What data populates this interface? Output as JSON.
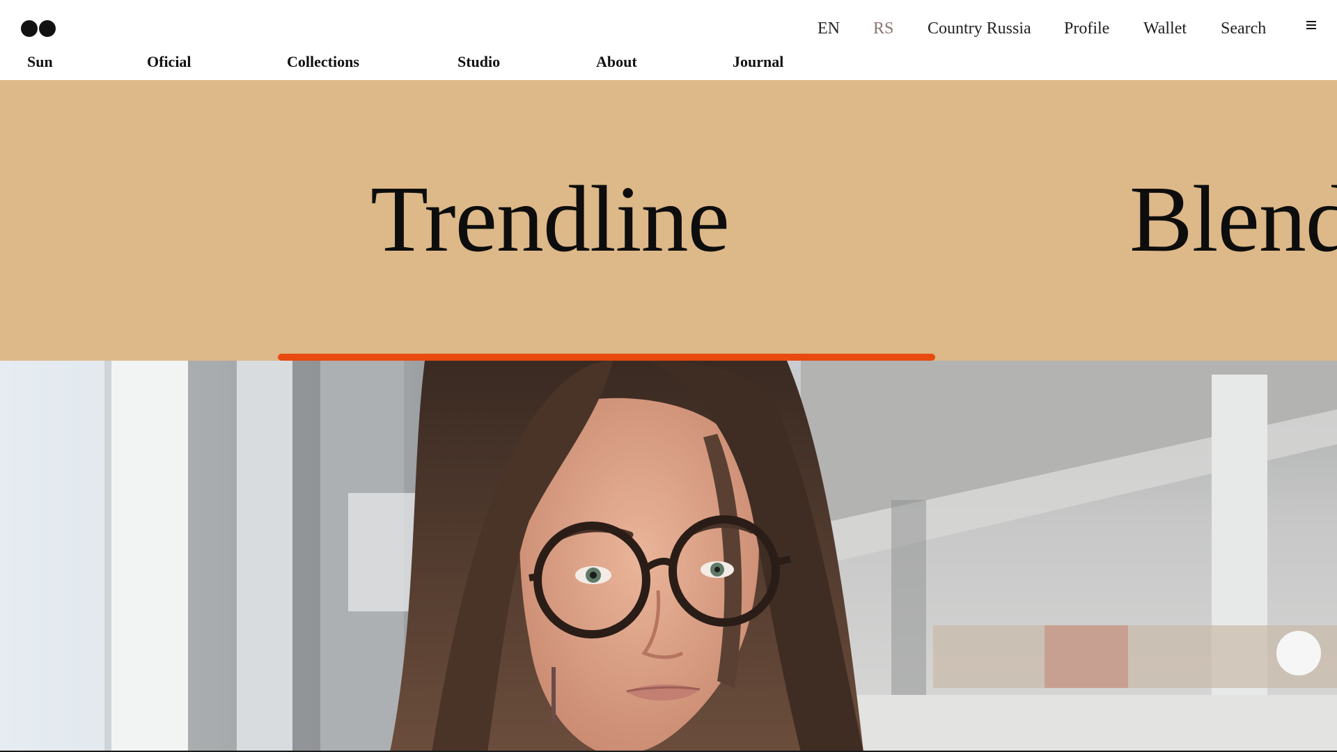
{
  "header": {
    "logo_icon": "two-dots-logo",
    "utility_nav": {
      "lang_en": "EN",
      "lang_rs": "RS",
      "country": "Country Russia",
      "profile": "Profile",
      "wallet": "Wallet",
      "search": "Search",
      "menu_icon": "hamburger-menu-icon"
    },
    "main_nav": {
      "items": [
        "Sun",
        "Oficial",
        "Collections",
        "Studio",
        "About",
        "Journal"
      ]
    }
  },
  "hero": {
    "background_color": "#ddb888",
    "slides": [
      "Trendline",
      "Blend"
    ],
    "progress_color": "#e84a0f"
  },
  "photo": {
    "subject": "woman-with-glasses-photo"
  }
}
